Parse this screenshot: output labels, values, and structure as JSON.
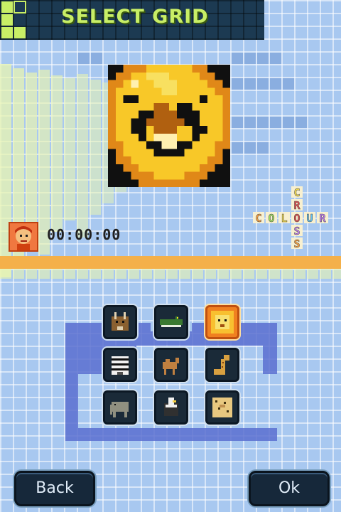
{
  "header": {
    "title": "SELECT GRID"
  },
  "timer": {
    "value": "00:00:00"
  },
  "logo": {
    "word_across": "COLOUR",
    "word_down": "CROSS"
  },
  "grid_thumbnails": [
    {
      "name": "antelope",
      "icon": "antelope-icon",
      "selected": false
    },
    {
      "name": "crocodile",
      "icon": "crocodile-icon",
      "selected": false
    },
    {
      "name": "lion",
      "icon": "lion-icon",
      "selected": true
    },
    {
      "name": "zebra",
      "icon": "zebra-icon",
      "selected": false
    },
    {
      "name": "camel",
      "icon": "camel-icon",
      "selected": false
    },
    {
      "name": "giraffe",
      "icon": "giraffe-icon",
      "selected": false
    },
    {
      "name": "elephant",
      "icon": "elephant-icon",
      "selected": false
    },
    {
      "name": "vulture",
      "icon": "vulture-icon",
      "selected": false
    },
    {
      "name": "leopard",
      "icon": "leopard-icon",
      "selected": false
    }
  ],
  "buttons": {
    "back": "Back",
    "ok": "Ok"
  },
  "colors": {
    "background": "#a8c8f0",
    "accent_green": "#c8ee66",
    "selected_orange": "#f08020",
    "header_dark": "#1c3a52"
  }
}
